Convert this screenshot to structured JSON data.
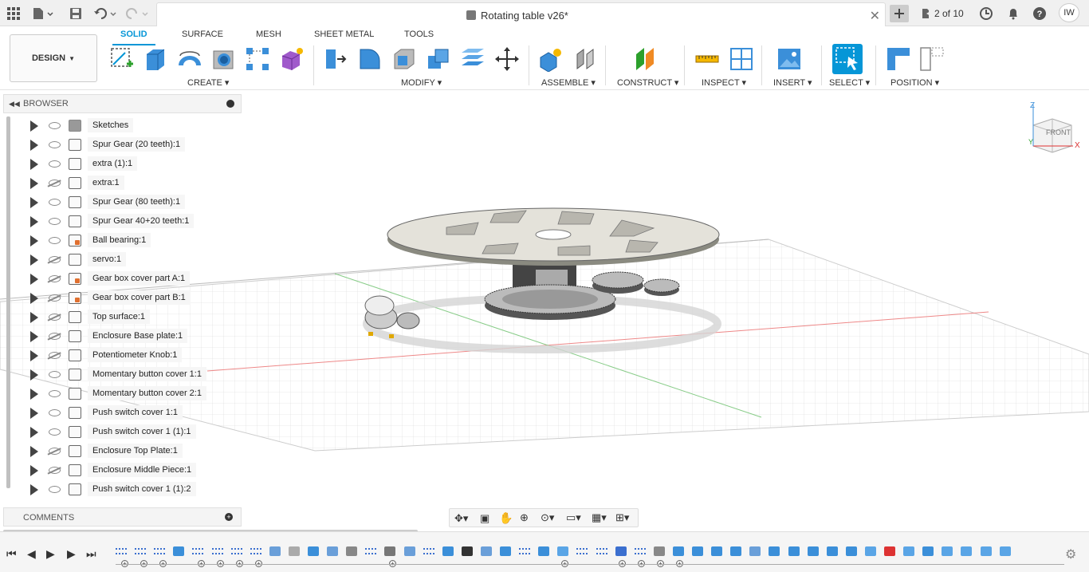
{
  "topbar": {
    "doc_title": "Rotating table v26*",
    "version_count": "2 of 10",
    "user_initials": "IW"
  },
  "ribbon": {
    "workspace": "DESIGN",
    "tabs": [
      "SOLID",
      "SURFACE",
      "MESH",
      "SHEET METAL",
      "TOOLS"
    ],
    "groups": [
      "CREATE",
      "MODIFY",
      "ASSEMBLE",
      "CONSTRUCT",
      "INSPECT",
      "INSERT",
      "SELECT",
      "POSITION"
    ]
  },
  "browser": {
    "title": "BROWSER",
    "items": [
      {
        "label": "Sketches",
        "visible": true,
        "kind": "folder"
      },
      {
        "label": "Spur Gear (20 teeth):1",
        "visible": true,
        "kind": "component"
      },
      {
        "label": "extra (1):1",
        "visible": true,
        "kind": "component"
      },
      {
        "label": "extra:1",
        "visible": false,
        "kind": "component"
      },
      {
        "label": "Spur Gear (80 teeth):1",
        "visible": true,
        "kind": "component"
      },
      {
        "label": "Spur Gear 40+20 teeth:1",
        "visible": true,
        "kind": "component"
      },
      {
        "label": "Ball bearing:1",
        "visible": true,
        "kind": "reference"
      },
      {
        "label": "servo:1",
        "visible": false,
        "kind": "component"
      },
      {
        "label": "Gear box cover part A:1",
        "visible": false,
        "kind": "reference"
      },
      {
        "label": "Gear box cover part B:1",
        "visible": false,
        "kind": "reference"
      },
      {
        "label": "Top surface:1",
        "visible": false,
        "kind": "component"
      },
      {
        "label": "Enclosure Base plate:1",
        "visible": false,
        "kind": "component"
      },
      {
        "label": "Potentiometer Knob:1",
        "visible": false,
        "kind": "component"
      },
      {
        "label": "Momentary button cover 1:1",
        "visible": true,
        "kind": "component"
      },
      {
        "label": "Momentary button cover 2:1",
        "visible": true,
        "kind": "component"
      },
      {
        "label": "Push switch cover 1:1",
        "visible": true,
        "kind": "component"
      },
      {
        "label": "Push switch cover 1 (1):1",
        "visible": true,
        "kind": "component"
      },
      {
        "label": "Enclosure Top Plate:1",
        "visible": false,
        "kind": "component"
      },
      {
        "label": "Enclosure Middle Piece:1",
        "visible": false,
        "kind": "component"
      },
      {
        "label": "Push switch cover 1 (1):2",
        "visible": true,
        "kind": "component"
      }
    ]
  },
  "comments": {
    "title": "COMMENTS"
  },
  "viewcube": {
    "face": "FRONT",
    "axis_z": "Z",
    "axis_x": "X",
    "axis_y": "Y"
  },
  "colors": {
    "accent": "#0696d7",
    "highlight": "#f4e000"
  }
}
